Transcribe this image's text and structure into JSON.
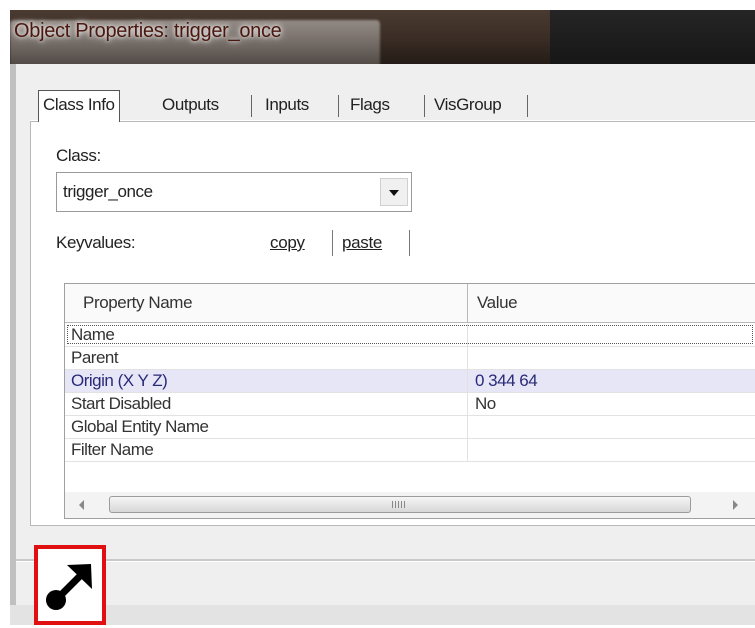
{
  "window": {
    "title": "Object Properties: trigger_once"
  },
  "tabs": [
    {
      "label": "Class Info",
      "active": true
    },
    {
      "label": "Outputs",
      "active": false
    },
    {
      "label": "Inputs",
      "active": false
    },
    {
      "label": "Flags",
      "active": false
    },
    {
      "label": "VisGroup",
      "active": false
    }
  ],
  "class_section": {
    "label": "Class:",
    "value": "trigger_once"
  },
  "keyvalues": {
    "label": "Keyvalues:",
    "copy_label": "copy",
    "paste_label": "paste"
  },
  "grid": {
    "headers": [
      "Property Name",
      "Value"
    ],
    "rows": [
      {
        "name": "Name",
        "value": "",
        "focused": true,
        "selected": false
      },
      {
        "name": "Parent",
        "value": "",
        "focused": false,
        "selected": false
      },
      {
        "name": "Origin (X Y Z)",
        "value": "0 344 64",
        "focused": false,
        "selected": true
      },
      {
        "name": "Start Disabled",
        "value": "No",
        "focused": false,
        "selected": false
      },
      {
        "name": "Global Entity Name",
        "value": "",
        "focused": false,
        "selected": false
      },
      {
        "name": "Filter Name",
        "value": "",
        "focused": false,
        "selected": false
      }
    ]
  },
  "icons": {
    "corner": "resize-arrow-icon",
    "scroll_left": "scroll-left-arrow-icon",
    "scroll_right": "scroll-right-arrow-icon",
    "combo": "dropdown-arrow-icon"
  },
  "colors": {
    "highlight_border": "#e01010",
    "selected_row": "#e6e6f7"
  }
}
